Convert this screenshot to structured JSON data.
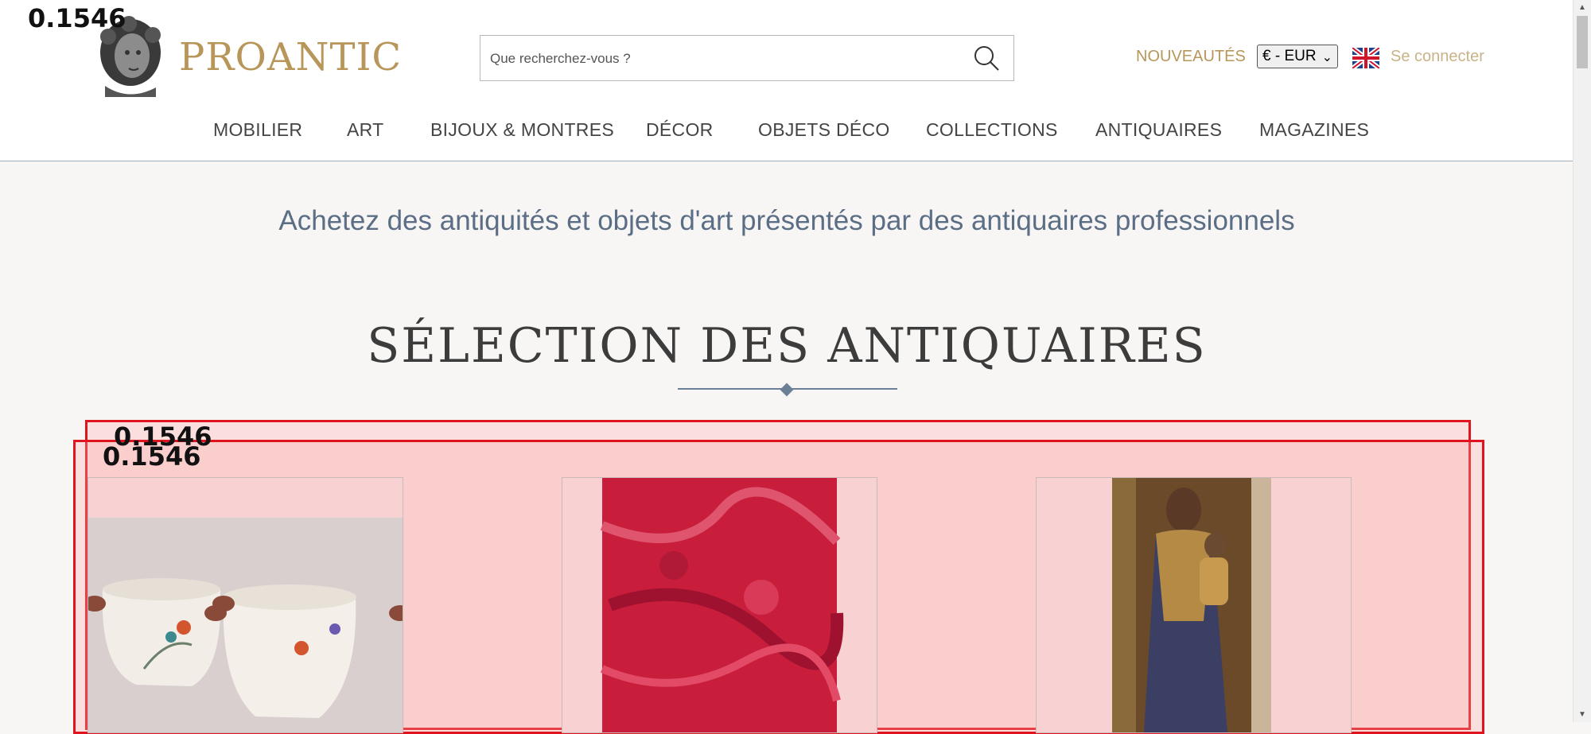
{
  "overlay_scores": [
    "0.1546",
    "0.1546",
    "0.1546"
  ],
  "brand": {
    "name": "PROANTIC"
  },
  "search": {
    "placeholder": "Que recherchez-vous ?"
  },
  "header": {
    "new_label": "NOUVEAUTÉS",
    "currency": "€ - EUR",
    "login_label": "Se connecter"
  },
  "nav": {
    "items": [
      "MOBILIER",
      "ART",
      "BIJOUX & MONTRES",
      "DÉCOR",
      "OBJETS DÉCO",
      "COLLECTIONS",
      "ANTIQUAIRES",
      "MAGAZINES"
    ]
  },
  "main": {
    "tagline": "Achetez des antiquités et objets d'art présentés par des antiquaires professionnels",
    "section_title": "SÉLECTION DES ANTIQUAIRES"
  },
  "colors": {
    "brand_gold": "#b8965a",
    "tagline_blue": "#5b6e86",
    "overlay_red": "#e0141e"
  }
}
